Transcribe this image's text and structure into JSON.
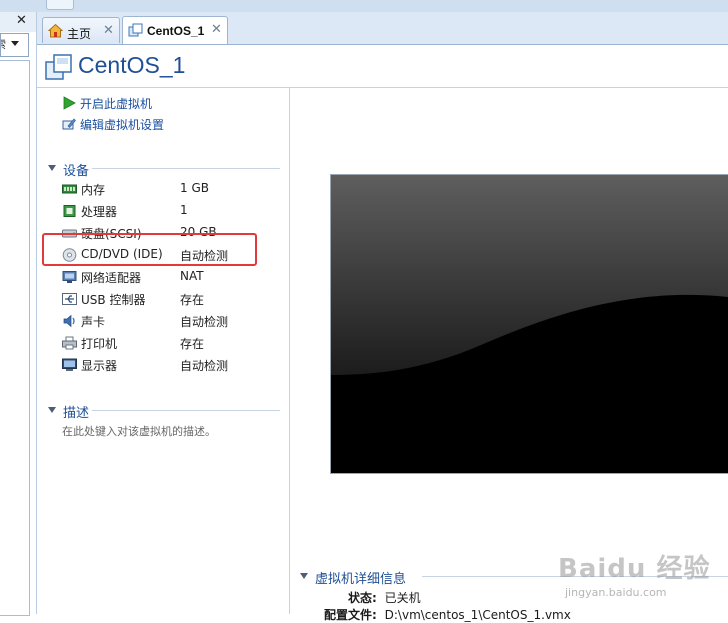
{
  "library": {
    "close_glyph": "✕",
    "search_text": "索"
  },
  "tabs": [
    {
      "label": "主页",
      "icon": "home-icon",
      "close": "✕"
    },
    {
      "label": "CentOS_1",
      "icon": "vm-icon",
      "close": "✕"
    }
  ],
  "vm": {
    "title": "CentOS_1"
  },
  "commands": [
    {
      "label": "开启此虚拟机",
      "icon": "play-icon"
    },
    {
      "label": "编辑虚拟机设置",
      "icon": "edit-settings-icon"
    }
  ],
  "devices": {
    "heading": "设备",
    "items": [
      {
        "name": "内存",
        "value": "1 GB",
        "icon": "memory-icon"
      },
      {
        "name": "处理器",
        "value": "1",
        "icon": "processor-icon"
      },
      {
        "name": "硬盘(SCSI)",
        "value": "20 GB",
        "icon": "hard-disk-icon"
      },
      {
        "name": "CD/DVD (IDE)",
        "value": "自动检测",
        "icon": "cd-dvd-icon"
      },
      {
        "name": "网络适配器",
        "value": "NAT",
        "icon": "network-adapter-icon"
      },
      {
        "name": "USB 控制器",
        "value": "存在",
        "icon": "usb-icon"
      },
      {
        "name": "声卡",
        "value": "自动检测",
        "icon": "sound-card-icon"
      },
      {
        "name": "打印机",
        "value": "存在",
        "icon": "printer-icon"
      },
      {
        "name": "显示器",
        "value": "自动检测",
        "icon": "display-icon"
      }
    ]
  },
  "description": {
    "heading": "描述",
    "placeholder": "在此处键入对该虚拟机的描述。"
  },
  "details": {
    "heading": "虚拟机详细信息",
    "state_label": "状态:",
    "state_value": "已关机",
    "config_label": "配置文件:",
    "config_value": "D:\\vm\\centos_1\\CentOS_1.vmx"
  },
  "watermark": {
    "text": "Baidu 经验",
    "sub": "jingyan.baidu.com"
  },
  "colors": {
    "link": "#1a4fa0",
    "heading": "#1f4f96",
    "highlight": "#e23a3a"
  }
}
